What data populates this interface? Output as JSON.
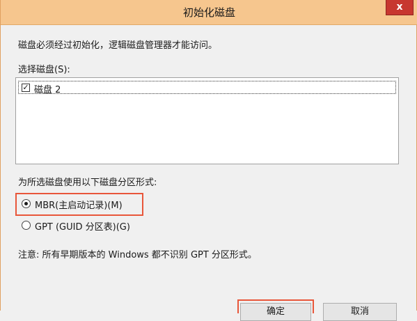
{
  "window": {
    "title": "初始化磁盘",
    "close_glyph": "x"
  },
  "dialog": {
    "description": "磁盘必须经过初始化，逻辑磁盘管理器才能访问。",
    "select_label": "选择磁盘(S):",
    "disks": [
      {
        "label": "磁盘 2",
        "checked": true,
        "check_glyph": "✓"
      }
    ],
    "partition_label": "为所选磁盘使用以下磁盘分区形式:",
    "options": [
      {
        "label": "MBR(主启动记录)(M)",
        "selected": true
      },
      {
        "label": "GPT (GUID 分区表)(G)",
        "selected": false
      }
    ],
    "note": "注意: 所有早期版本的 Windows 都不识别 GPT 分区形式。"
  },
  "buttons": {
    "ok_label": "确定",
    "cancel_label": "取消"
  },
  "colors": {
    "titlebar": "#f6c68e",
    "close_button": "#c7372f",
    "highlight": "#e8563a"
  }
}
